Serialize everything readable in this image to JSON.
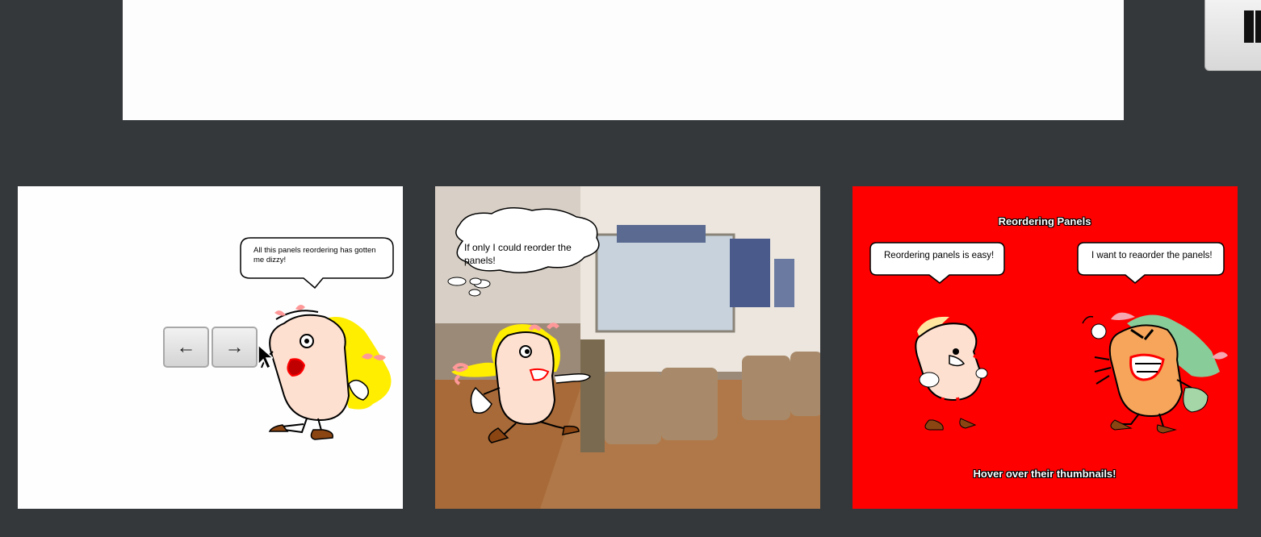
{
  "panels": [
    {
      "speech": "All this panels reordering has gotten me dizzy!",
      "nav": {
        "prev_icon": "←",
        "next_icon": "→"
      }
    },
    {
      "thought": "If only I could reorder the panels!"
    },
    {
      "title": "Reordering Panels",
      "speech_left": "Reordering panels is easy!",
      "speech_right": "I want to reaorder the panels!",
      "footer": "Hover over their thumbnails!"
    }
  ],
  "colors": {
    "page_bg": "#35383b",
    "panel_red": "#fe0000",
    "hair_yellow": "#ffee00",
    "hair_green": "#88cc99",
    "skin": "#fde0d0"
  },
  "icons": [
    "corner-button-icon",
    "arrow-left-icon",
    "arrow-right-icon",
    "mouse-cursor-icon"
  ]
}
